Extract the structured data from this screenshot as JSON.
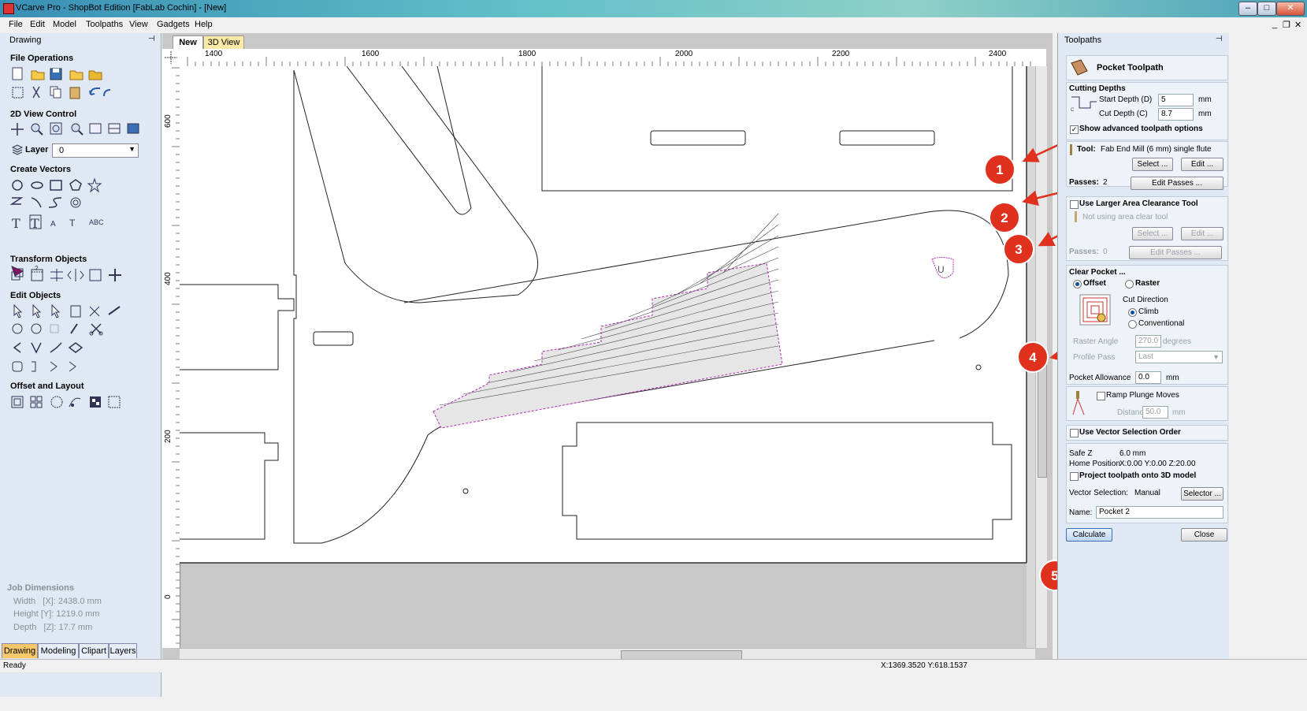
{
  "window": {
    "title": "VCarve Pro - ShopBot Edition [FabLab Cochin] - [New]"
  },
  "menu": [
    "File",
    "Edit",
    "Model",
    "Toolpaths",
    "View",
    "Gadgets",
    "Help"
  ],
  "left_panel": {
    "title": "Drawing",
    "sections": {
      "file_ops": "File Operations",
      "view_2d": "2D View Control",
      "layer_label": "Layer",
      "layer_value": "0",
      "create_vectors": "Create Vectors",
      "transform": "Transform Objects",
      "edit_objects": "Edit Objects",
      "offset_layout": "Offset and Layout"
    },
    "job": {
      "heading": "Job Dimensions",
      "width": "Width   [X]: 2438.0 mm",
      "height": "Height [Y]: 1219.0 mm",
      "depth": "Depth   [Z]: 17.7 mm"
    },
    "tabs": [
      "Drawing",
      "Modeling",
      "Clipart",
      "Layers"
    ]
  },
  "document_tabs": [
    "New",
    "3D View"
  ],
  "ruler": {
    "h": [
      "1400",
      "1600",
      "1800",
      "2000",
      "2200",
      "2400"
    ],
    "v": [
      "600",
      "400",
      "200",
      "0"
    ]
  },
  "annotations": [
    "1",
    "2",
    "3",
    "4",
    "5"
  ],
  "right_panel": {
    "title": "Toolpaths",
    "header": "Pocket Toolpath",
    "cutting_depths": "Cutting Depths",
    "start_depth_label": "Start Depth (D)",
    "start_depth": "5",
    "cut_depth_label": "Cut Depth (C)",
    "cut_depth": "8.7",
    "unit": "mm",
    "show_advanced": "Show advanced toolpath options",
    "tool_label": "Tool:",
    "tool_value": "Fab End Mill (6 mm) single flute",
    "select_btn": "Select ...",
    "edit_btn": "Edit ...",
    "passes_label": "Passes:",
    "passes_value": "2",
    "edit_passes_btn": "Edit Passes ...",
    "larger_area": "Use Larger Area Clearance Tool",
    "not_using": "Not using area clear tool",
    "passes2_value": "0",
    "clear_pocket": "Clear Pocket ...",
    "offset": "Offset",
    "raster": "Raster",
    "cut_direction": "Cut Direction",
    "climb": "Climb",
    "conventional": "Conventional",
    "raster_angle_label": "Raster Angle",
    "raster_angle": "270.0",
    "degrees": "degrees",
    "profile_pass_label": "Profile Pass",
    "profile_pass": "Last",
    "pocket_allowance_label": "Pocket Allowance",
    "pocket_allowance": "0.0",
    "ramp": "Ramp Plunge Moves",
    "distance_label": "Distance",
    "distance": "50.0",
    "vector_order": "Use Vector Selection Order",
    "safe_z_label": "Safe Z",
    "safe_z": "6.0 mm",
    "home_label": "Home Position",
    "home": "X:0.00 Y:0.00 Z:20.00",
    "project": "Project toolpath onto 3D model",
    "vector_sel_label": "Vector Selection:",
    "vector_sel": "Manual",
    "selector_btn": "Selector ...",
    "name_label": "Name:",
    "name_value": "Pocket 2",
    "calculate": "Calculate",
    "close": "Close"
  },
  "status": {
    "left": "Ready",
    "coords": "X:1369.3520 Y:618.1537"
  },
  "colors": {
    "annotation": "#e0301e",
    "panel": "#dfe8f3",
    "toolpath": "#b030b0"
  }
}
